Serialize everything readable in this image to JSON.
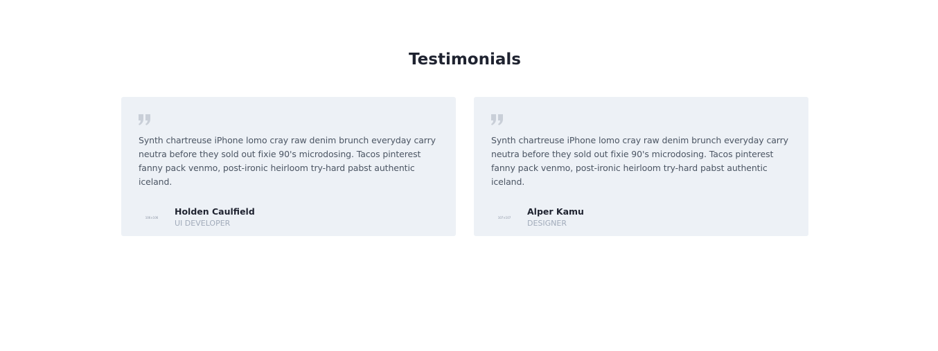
{
  "section": {
    "title": "Testimonials"
  },
  "testimonials": [
    {
      "quote": "Synth chartreuse iPhone lomo cray raw denim brunch everyday carry neutra before they sold out fixie 90's microdosing. Tacos pinterest fanny pack venmo, post-ironic heirloom try-hard pabst authentic iceland.",
      "avatar_text": "106×106",
      "name": "Holden Caulfield",
      "role": "UI DEVELOPER"
    },
    {
      "quote": "Synth chartreuse iPhone lomo cray raw denim brunch everyday carry neutra before they sold out fixie 90's microdosing. Tacos pinterest fanny pack venmo, post-ironic heirloom try-hard pabst authentic iceland.",
      "avatar_text": "107×107",
      "name": "Alper Kamu",
      "role": "DESIGNER"
    }
  ],
  "colors": {
    "card_bg": "#edf1f6",
    "quote_icon": "#c9cfd8",
    "title": "#1f2330",
    "body": "#4b5563",
    "role": "#a1abba"
  },
  "icons": {
    "quote": "quote-icon"
  }
}
